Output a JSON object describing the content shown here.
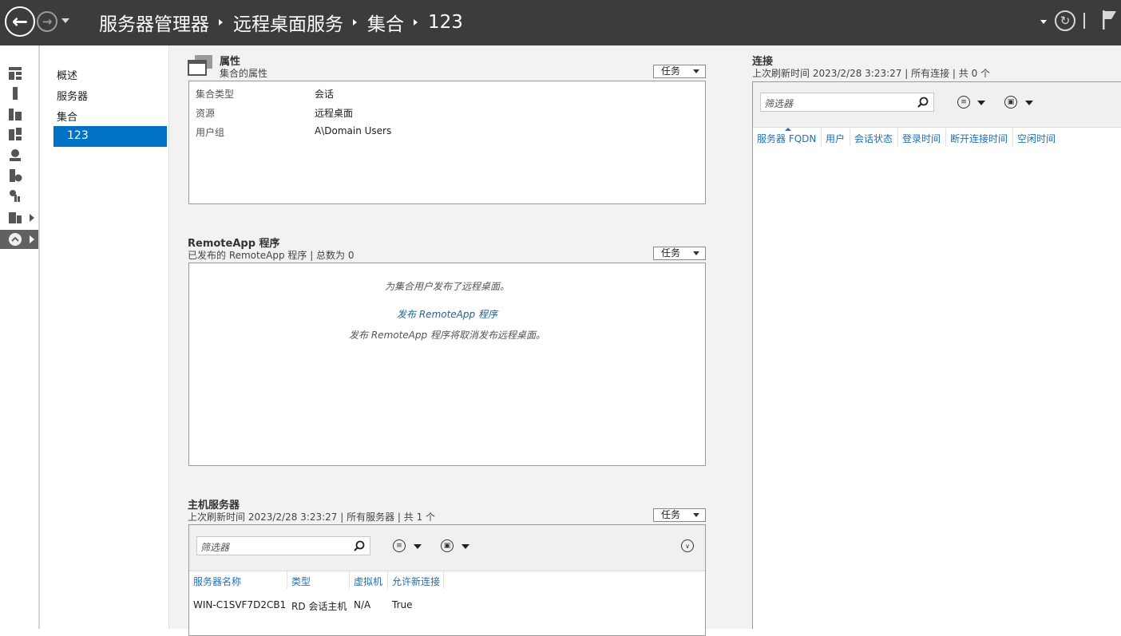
{
  "breadcrumb": {
    "items": [
      "服务器管理器",
      "远程桌面服务",
      "集合",
      "123"
    ]
  },
  "nav": {
    "items": [
      "概述",
      "服务器",
      "集合"
    ],
    "selected": "123"
  },
  "properties": {
    "title": "属性",
    "subtitle": "集合的属性",
    "tasks": "任务",
    "rows": [
      {
        "k": "集合类型",
        "v": "会话"
      },
      {
        "k": "资源",
        "v": "远程桌面"
      },
      {
        "k": "用户组",
        "v": "A\\Domain Users"
      }
    ]
  },
  "remoteapp": {
    "title": "RemoteApp 程序",
    "subtitle": "已发布的 RemoteApp 程序 | 总数为 0",
    "tasks": "任务",
    "msg": "为集合用户发布了远程桌面。",
    "link": "发布 RemoteApp 程序",
    "note": "发布 RemoteApp 程序将取消发布远程桌面。"
  },
  "hosts": {
    "title": "主机服务器",
    "subtitle": "上次刷新时间 2023/2/28 3:23:27 | 所有服务器 | 共 1 个",
    "tasks": "任务",
    "filter_placeholder": "筛选器",
    "columns": [
      "服务器名称",
      "类型",
      "虚拟机",
      "允许新连接"
    ],
    "rows": [
      [
        "WIN-C1SVF7D2CB1",
        "RD 会话主机",
        "N/A",
        "True"
      ]
    ]
  },
  "connections": {
    "title": "连接",
    "subtitle": "上次刷新时间 2023/2/28 3:23:27 | 所有连接 | 共 0 个",
    "filter_placeholder": "筛选器",
    "columns": [
      "服务器 FQDN",
      "用户",
      "会话状态",
      "登录时间",
      "断开连接时间",
      "空闲时间"
    ]
  },
  "icons": {
    "back": "back-arrow-icon",
    "forward": "forward-arrow-icon",
    "refresh": "refresh-icon",
    "flag": "flag-icon",
    "search": "search-icon"
  },
  "colors": {
    "topbar": "#3c3c3c",
    "accent": "#0072c6",
    "panel": "#f2f2f2",
    "link": "#1f6fb6"
  }
}
